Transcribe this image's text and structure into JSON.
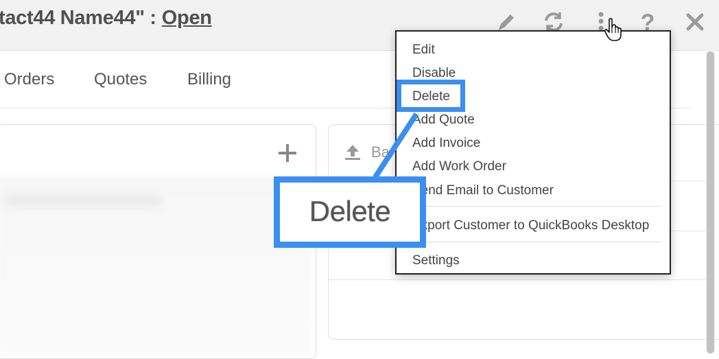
{
  "header": {
    "title": "tact44 Name44\" :",
    "status": "Open",
    "icons": [
      "pencil-icon",
      "refresh-icon",
      "more-vertical-icon",
      "help-icon",
      "close-icon"
    ]
  },
  "tabs": [
    "Orders",
    "Quotes",
    "Billing"
  ],
  "right_panel": {
    "header_partial": "Ba"
  },
  "menu": {
    "items": [
      "Edit",
      "Disable",
      "Delete",
      "Add Quote",
      "Add Invoice",
      "Add Work Order",
      "Send Email to Customer",
      "Export Customer to QuickBooks Desktop",
      "Settings"
    ]
  },
  "callout": {
    "label": "Delete"
  },
  "colors": {
    "accent": "#3b8ff0",
    "header_bg": "#f2f2f2",
    "text": "#333333",
    "icon": "#9a9a9a"
  }
}
